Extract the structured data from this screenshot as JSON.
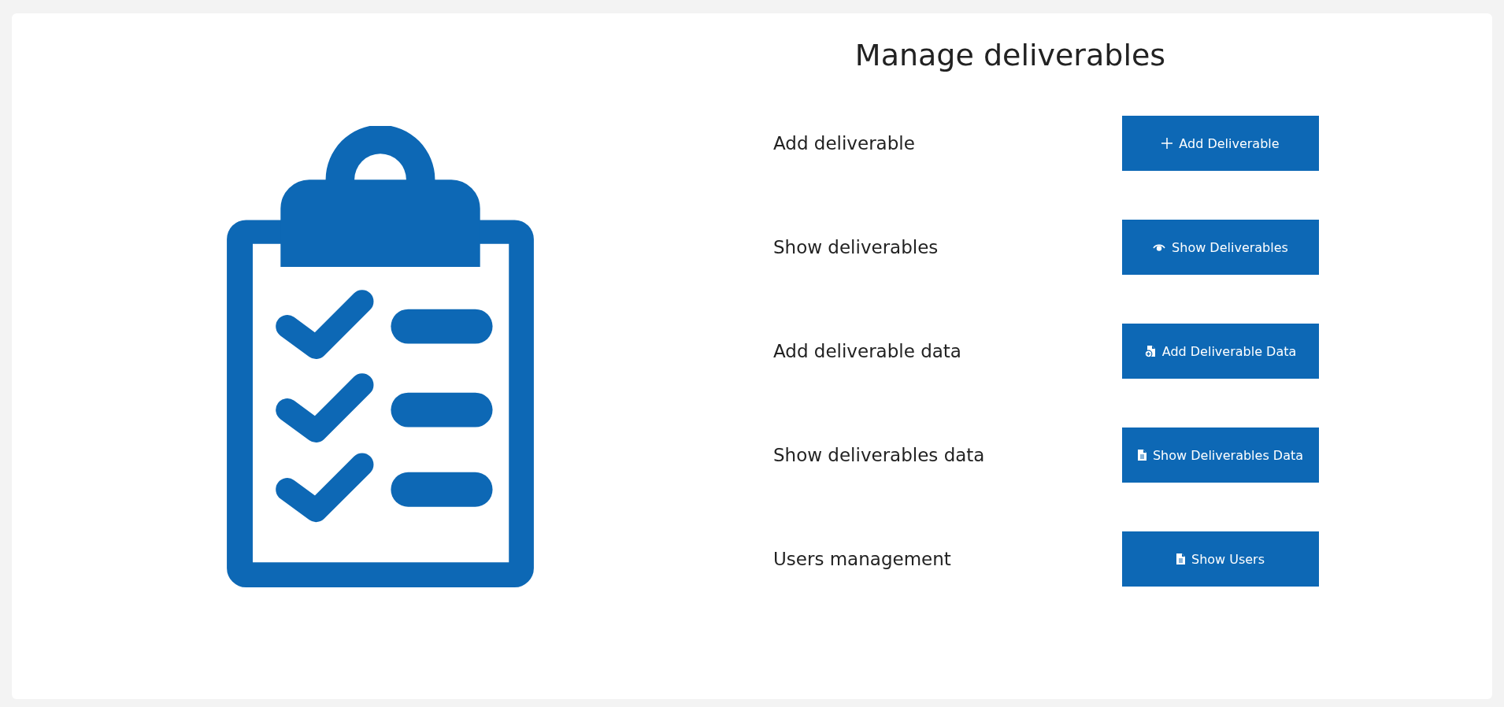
{
  "title": "Manage deliverables",
  "actions": [
    {
      "label": "Add deliverable",
      "button": "Add Deliverable",
      "kind": "add"
    },
    {
      "label": "Show deliverables",
      "button": "Show Deliverables",
      "kind": "view"
    },
    {
      "label": "Add deliverable data",
      "button": "Add Deliverable Data",
      "kind": "adddata"
    },
    {
      "label": "Show deliverables data",
      "button": "Show Deliverables Data",
      "kind": "list"
    },
    {
      "label": "Users management",
      "button": "Show Users",
      "kind": "list"
    }
  ]
}
